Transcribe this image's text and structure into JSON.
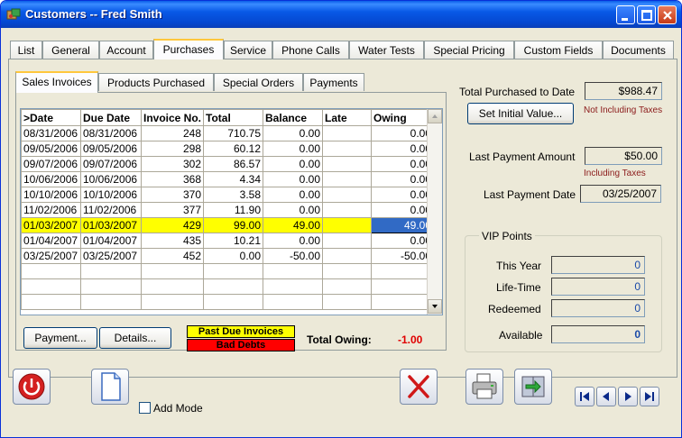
{
  "window": {
    "title": "Customers -- Fred Smith"
  },
  "tabs": [
    "List",
    "General",
    "Account",
    "Purchases",
    "Service",
    "Phone Calls",
    "Water Tests",
    "Special Pricing",
    "Custom Fields",
    "Documents"
  ],
  "subtabs": [
    "Sales Invoices",
    "Products Purchased",
    "Special Orders",
    "Payments"
  ],
  "grid": {
    "columns": [
      ">Date",
      "Due Date",
      "Invoice No.",
      "Total",
      "Balance",
      "Late",
      "Owing"
    ],
    "rows": [
      [
        "08/31/2006",
        "08/31/2006",
        "248",
        "710.75",
        "0.00",
        "",
        "0.00"
      ],
      [
        "09/05/2006",
        "09/05/2006",
        "298",
        "60.12",
        "0.00",
        "",
        "0.00"
      ],
      [
        "09/07/2006",
        "09/07/2006",
        "302",
        "86.57",
        "0.00",
        "",
        "0.00"
      ],
      [
        "10/06/2006",
        "10/06/2006",
        "368",
        "4.34",
        "0.00",
        "",
        "0.00"
      ],
      [
        "10/10/2006",
        "10/10/2006",
        "370",
        "3.58",
        "0.00",
        "",
        "0.00"
      ],
      [
        "11/02/2006",
        "11/02/2006",
        "377",
        "11.90",
        "0.00",
        "",
        "0.00"
      ],
      [
        "01/03/2007",
        "01/03/2007",
        "429",
        "99.00",
        "49.00",
        "",
        "49.00"
      ],
      [
        "01/04/2007",
        "01/04/2007",
        "435",
        "10.21",
        "0.00",
        "",
        "0.00"
      ],
      [
        "03/25/2007",
        "03/25/2007",
        "452",
        "0.00",
        "-50.00",
        "",
        "-50.00"
      ],
      [
        "",
        "",
        "",
        "",
        "",
        "",
        ""
      ],
      [
        "",
        "",
        "",
        "",
        "",
        "",
        ""
      ],
      [
        "",
        "",
        "",
        "",
        "",
        "",
        ""
      ]
    ],
    "selected_row": 6
  },
  "buttons": {
    "payment": "Payment...",
    "details": "Details...",
    "set_initial": "Set Initial Value..."
  },
  "legend": {
    "past_due": "Past Due Invoices",
    "bad_debts": "Bad Debts",
    "past_due_color": "#FFFF00",
    "bad_debts_color": "#FF0000"
  },
  "totals": {
    "owing_label": "Total Owing:",
    "owing_value": "-1.00"
  },
  "summary": {
    "total_purchased_label": "Total Purchased to Date",
    "total_purchased_value": "$988.47",
    "not_including_taxes": "Not Including Taxes",
    "last_payment_amount_label": "Last Payment Amount",
    "last_payment_amount_value": "$50.00",
    "including_taxes": "Including Taxes",
    "last_payment_date_label": "Last Payment Date",
    "last_payment_date_value": "03/25/2007"
  },
  "vip": {
    "title": "VIP Points",
    "this_year_label": "This Year",
    "this_year_value": "0",
    "lifetime_label": "Life-Time",
    "lifetime_value": "0",
    "redeemed_label": "Redeemed",
    "redeemed_value": "0",
    "available_label": "Available",
    "available_value": "0"
  },
  "toolbar": {
    "add_mode_label": "Add Mode"
  },
  "icons": [
    "power-icon",
    "new-document-icon",
    "delete-x-icon",
    "print-icon",
    "export-icon",
    "first-record-icon",
    "previous-record-icon",
    "next-record-icon",
    "last-record-icon"
  ]
}
